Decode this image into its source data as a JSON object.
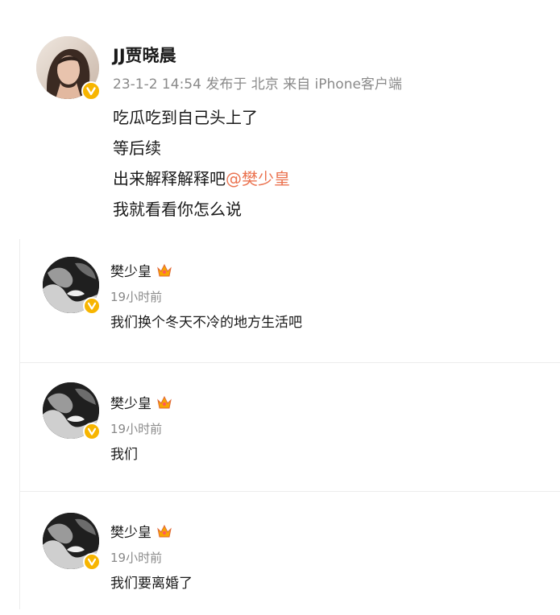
{
  "post": {
    "author": "JJ贾晓晨",
    "meta": "23-1-2 14:54  发布于 北京  来自 iPhone客户端",
    "lines": [
      "吃瓜吃到自己头上了",
      "等后续",
      "出来解释解释吧",
      "我就看看你怎么说"
    ],
    "mention": "@樊少皇",
    "avatar_icon": "user-avatar-photo",
    "badge_icon": "verified-v-badge-icon"
  },
  "comments": [
    {
      "author": "樊少皇",
      "time": "19小时前",
      "text": "我们换个冬天不冷的地方生活吧"
    },
    {
      "author": "樊少皇",
      "time": "19小时前",
      "text": "我们"
    },
    {
      "author": "樊少皇",
      "time": "19小时前",
      "text": "我们要离婚了"
    }
  ],
  "colors": {
    "mention": "#eb7350",
    "meta": "#8a8a8a",
    "badge": "#f7b500",
    "divider": "#ececec"
  }
}
